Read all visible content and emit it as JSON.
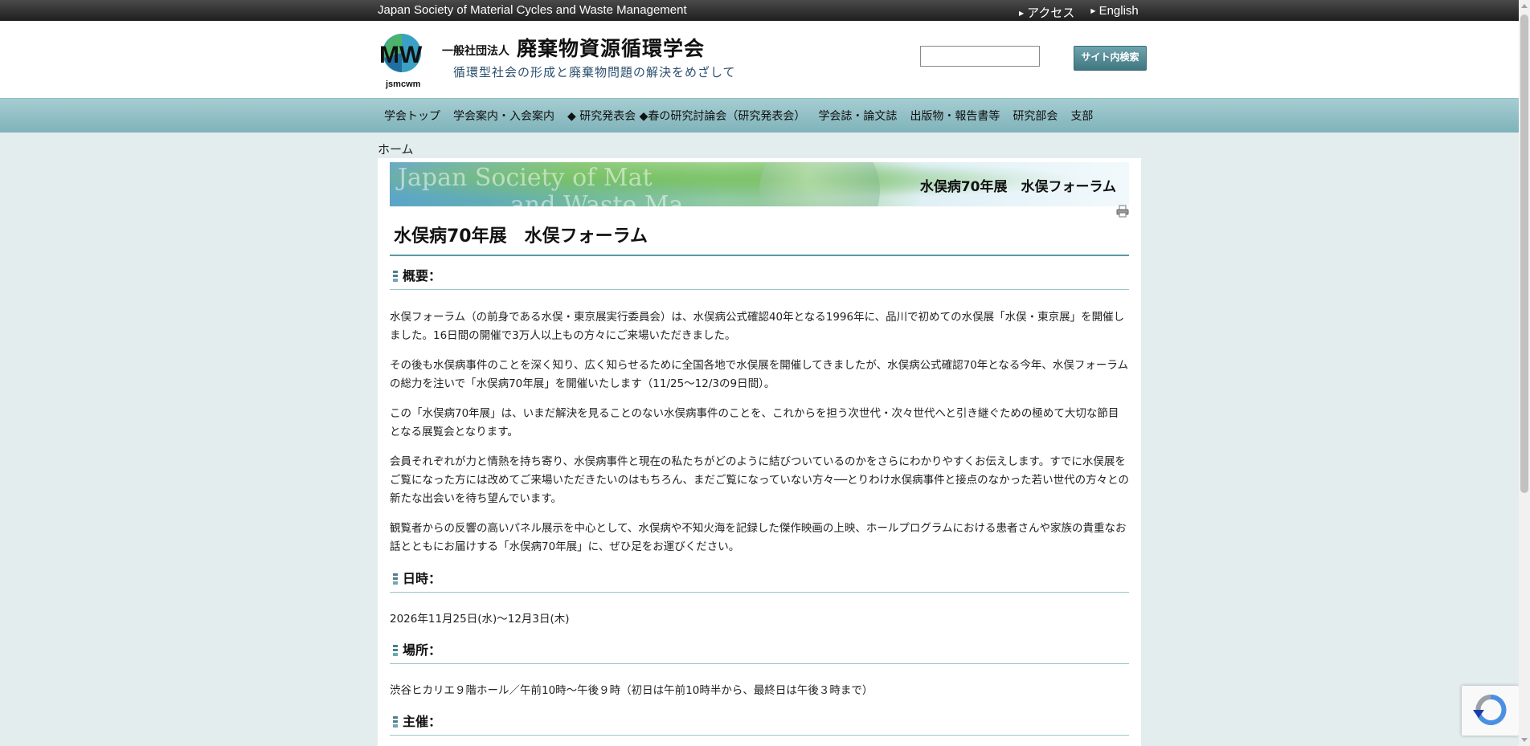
{
  "topbar": {
    "society_name": "Japan Society of Material Cycles and Waste Management",
    "links": [
      {
        "label": "アクセス"
      },
      {
        "label": "English"
      }
    ]
  },
  "header": {
    "logo_text": "MW",
    "logo_subtext": "jsmcwm",
    "org_kind": "一般社団法人",
    "org_name": "廃棄物資源循環学会",
    "tagline": "循環型社会の形成と廃棄物問題の解決をめざして",
    "search": {
      "value": "",
      "button_label": "サイト内検索"
    }
  },
  "nav": {
    "items": [
      {
        "label": "学会トップ"
      },
      {
        "label": "学会案内・入会案内"
      },
      {
        "label": "◆ 研究発表会 ◆春の研究討論会（研究発表会）"
      },
      {
        "label": "学会誌・論文誌"
      },
      {
        "label": "出版物・報告書等"
      },
      {
        "label": "研究部会"
      },
      {
        "label": "支部"
      }
    ]
  },
  "breadcrumb": {
    "home": "ホーム"
  },
  "banner": {
    "ghost_line1": "Japan Society of Mat",
    "ghost_line2": "and Waste Ma",
    "title": "水俣病70年展　水俣フォーラム"
  },
  "page": {
    "title": "水俣病70年展　水俣フォーラム",
    "sections": {
      "overview": {
        "heading": "概要：",
        "paragraphs": [
          "水俣フォーラム（の前身である水俣・東京展実行委員会）は、水俣病公式確認40年となる1996年に、品川で初めての水俣展「水俣・東京展」を開催しました。16日間の開催で3万人以上もの方々にご来場いただきました。",
          "その後も水俣病事件のことを深く知り、広く知らせるために全国各地で水俣展を開催してきましたが、水俣病公式確認70年となる今年、水俣フォーラムの総力を注いで「水俣病70年展」を開催いたします（11/25〜12/3の9日間）。",
          "この「水俣病70年展」は、いまだ解決を見ることのない水俣病事件のことを、これからを担う次世代・次々世代へと引き継ぐための極めて大切な節目となる展覧会となります。",
          "会員それぞれが力と情熱を持ち寄り、水俣病事件と現在の私たちがどのように結びついているのかをさらにわかりやすくお伝えします。すでに水俣展をご覧になった方には改めてご来場いただきたいのはもちろん、まだご覧になっていない方々──とりわけ水俣病事件と接点のなかった若い世代の方々との新たな出会いを待ち望んでいます。",
          "観覧者からの反響の高いパネル展示を中心として、水俣病や不知火海を記録した傑作映画の上映、ホールプログラムにおける患者さんや家族の貴重なお話とともにお届けする「水俣病70年展」に、ぜひ足をお運びください。"
        ]
      },
      "datetime": {
        "heading": "日時：",
        "text": "2026年11月25日(水)〜12月3日(木)"
      },
      "venue": {
        "heading": "場所：",
        "text": "渋谷ヒカリエ９階ホール／午前10時〜午後９時（初日は午前10時半から、最終日は午後３時まで）"
      },
      "organizer": {
        "heading": "主催："
      }
    }
  }
}
